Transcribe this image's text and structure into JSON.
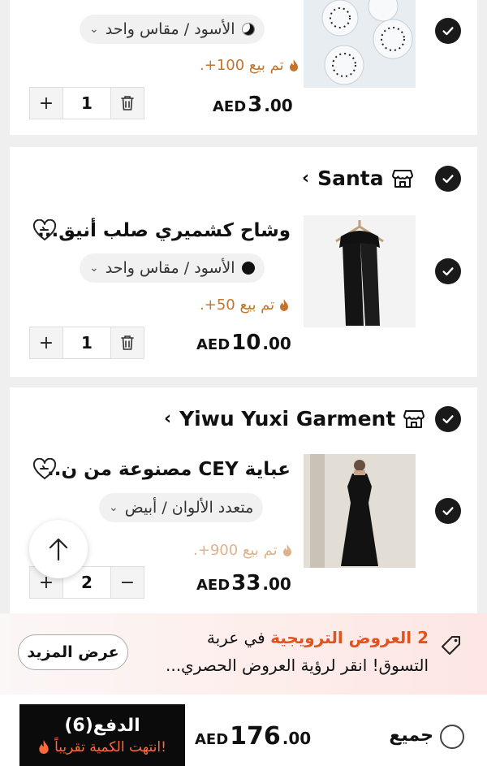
{
  "items": [
    {
      "variant": "الأسود / مقاس واحد",
      "sold": "تم بيع 100+.",
      "currency": "AED",
      "price_int": "3",
      "price_dec": ".00",
      "qty": "1"
    },
    {
      "store": "Santa",
      "title": "وشاح كشميري صلب أنيق...",
      "variant": "الأسود / مقاس واحد",
      "sold": "تم بيع 50+.",
      "currency": "AED",
      "price_int": "10",
      "price_dec": ".00",
      "qty": "1"
    },
    {
      "store": "Yiwu Yuxi Garment",
      "title": "عباية CEY مصنوعة من ن..",
      "variant": "متعدد الألوان / أبيض",
      "sold": "تم بيع 900+.",
      "currency": "AED",
      "price_int": "33",
      "price_dec": ".00",
      "qty": "2"
    }
  ],
  "promo": {
    "count_text": "2 العروض الترويجية",
    "line1_rest": " في عربة",
    "line2": "التسوق! انقر لرؤية العروض الحصري...",
    "button": "عرض المزيد"
  },
  "bottom": {
    "select_all": "جميع",
    "currency": "AED",
    "total_int": "176",
    "total_dec": ".00",
    "pay_label": "الدفع(6)",
    "pay_note": "انتهت الكمية تقريباً!"
  },
  "colors": {
    "sold_text": "#c4752b",
    "promo_highlight": "#e0531f",
    "pay_button_bg": "#0b0b0b"
  }
}
